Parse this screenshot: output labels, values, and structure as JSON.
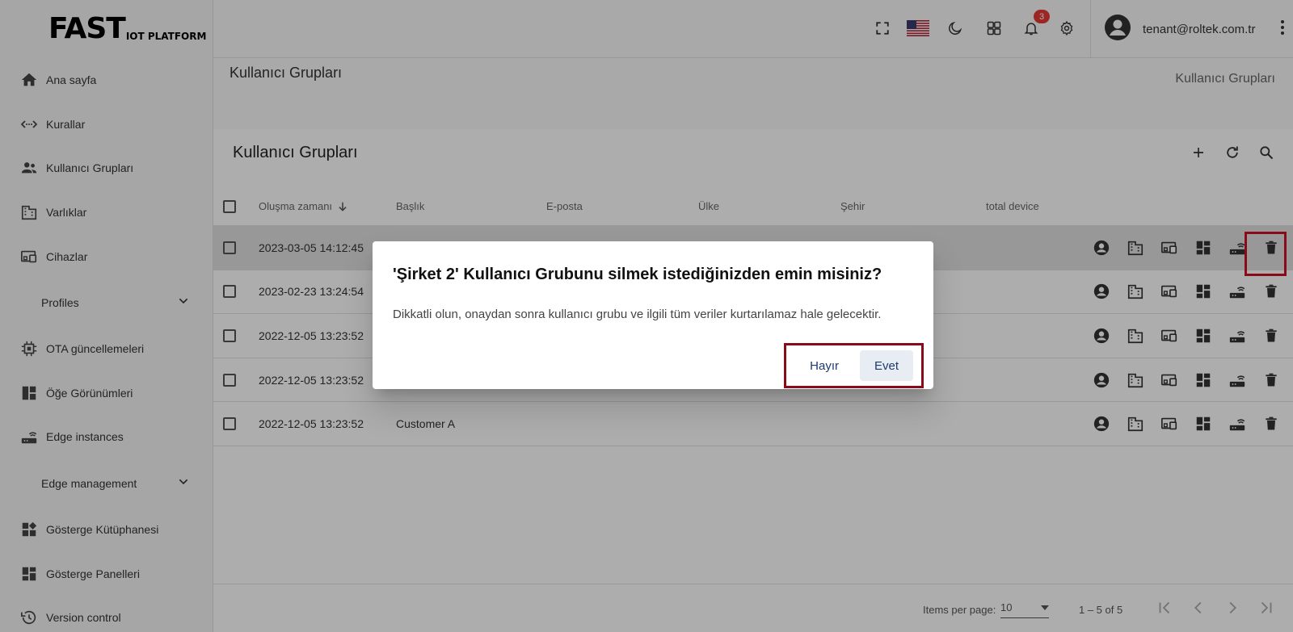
{
  "logo": {
    "big": "FAST",
    "small": "IOT PLATFORM"
  },
  "sidebar": {
    "items": [
      {
        "label": "Ana sayfa",
        "icon": "home-icon"
      },
      {
        "label": "Kurallar",
        "icon": "rule-chain-icon"
      },
      {
        "label": "Kullanıcı Grupları",
        "icon": "users-icon"
      },
      {
        "label": "Varlıklar",
        "icon": "building-icon"
      },
      {
        "label": "Cihazlar",
        "icon": "devices-icon"
      }
    ],
    "section1": "Profiles",
    "items2": [
      {
        "label": "OTA güncellemeleri",
        "icon": "chip-icon"
      },
      {
        "label": "Öğe Görünümleri",
        "icon": "widgets-icon"
      },
      {
        "label": "Edge instances",
        "icon": "router-icon"
      }
    ],
    "section2": "Edge management",
    "items3": [
      {
        "label": "Gösterge Kütüphanesi",
        "icon": "widget-library-icon"
      },
      {
        "label": "Gösterge Panelleri",
        "icon": "dashboard-icon"
      },
      {
        "label": "Version control",
        "icon": "history-icon"
      }
    ]
  },
  "topbar": {
    "notifications_count": "3",
    "user_email": "tenant@roltek.com.tr"
  },
  "page": {
    "breadcrumb_title": "Kullanıcı Grupları",
    "breadcrumb_right": "Kullanıcı Grupları",
    "card_title": "Kullanıcı Grupları"
  },
  "table": {
    "columns": [
      "Oluşma zamanı",
      "Başlık",
      "E-posta",
      "Ülke",
      "Şehir",
      "total device"
    ],
    "rows": [
      {
        "created": "2023-03-05 14:12:45",
        "title": ""
      },
      {
        "created": "2023-02-23 13:24:54",
        "title": ""
      },
      {
        "created": "2022-12-05 13:23:52",
        "title": ""
      },
      {
        "created": "2022-12-05 13:23:52",
        "title": ""
      },
      {
        "created": "2022-12-05 13:23:52",
        "title": "Customer A"
      }
    ]
  },
  "paginator": {
    "items_per_page_label": "Items per page:",
    "page_size": "10",
    "range": "1 – 5 of 5"
  },
  "dialog": {
    "title": "'Şirket 2' Kullanıcı Grubunu silmek istediğinizden emin misiniz?",
    "text": "Dikkatli olun, onaydan sonra kullanıcı grubu ve ilgili tüm veriler kurtarılamaz hale gelecektir.",
    "no_label": "Hayır",
    "yes_label": "Evet"
  }
}
